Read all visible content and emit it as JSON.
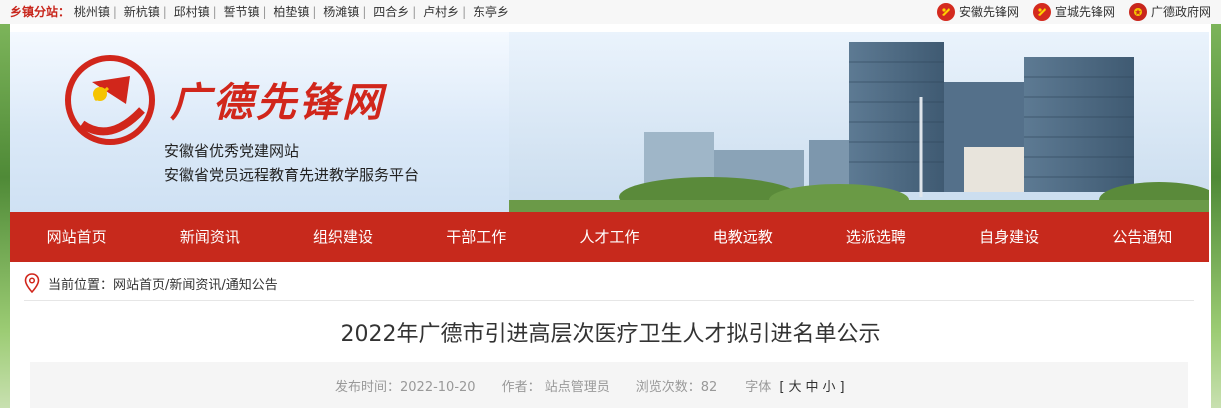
{
  "topbar": {
    "label": "乡镇分站：",
    "towns": [
      "桃州镇",
      "新杭镇",
      "邱村镇",
      "誓节镇",
      "柏垫镇",
      "杨滩镇",
      "四合乡",
      "卢村乡",
      "东亭乡"
    ],
    "links": [
      "安徽先锋网",
      "宣城先锋网",
      "广德政府网"
    ],
    "brand_color": "#d42a1e"
  },
  "banner": {
    "site_title": "广德先锋网",
    "slogan1": "安徽省优秀党建网站",
    "slogan2": "安徽省党员远程教育先进教学服务平台"
  },
  "nav": {
    "items": [
      "网站首页",
      "新闻资讯",
      "组织建设",
      "干部工作",
      "人才工作",
      "电教远教",
      "选派选聘",
      "自身建设",
      "公告通知"
    ],
    "color": "#c7291c"
  },
  "breadcrumb": {
    "label": "当前位置：",
    "path": "网站首页/新闻资讯/通知公告"
  },
  "article": {
    "title": "2022年广德市引进高层次医疗卫生人才拟引进名单公示",
    "publish": "发布时间：2022-10-20",
    "author": "作者：  站点管理员",
    "views": "浏览次数：82",
    "font_label": "字体",
    "font_open": "[",
    "font_big": "大",
    "font_mid": "中",
    "font_small": "小",
    "font_close": "]"
  }
}
